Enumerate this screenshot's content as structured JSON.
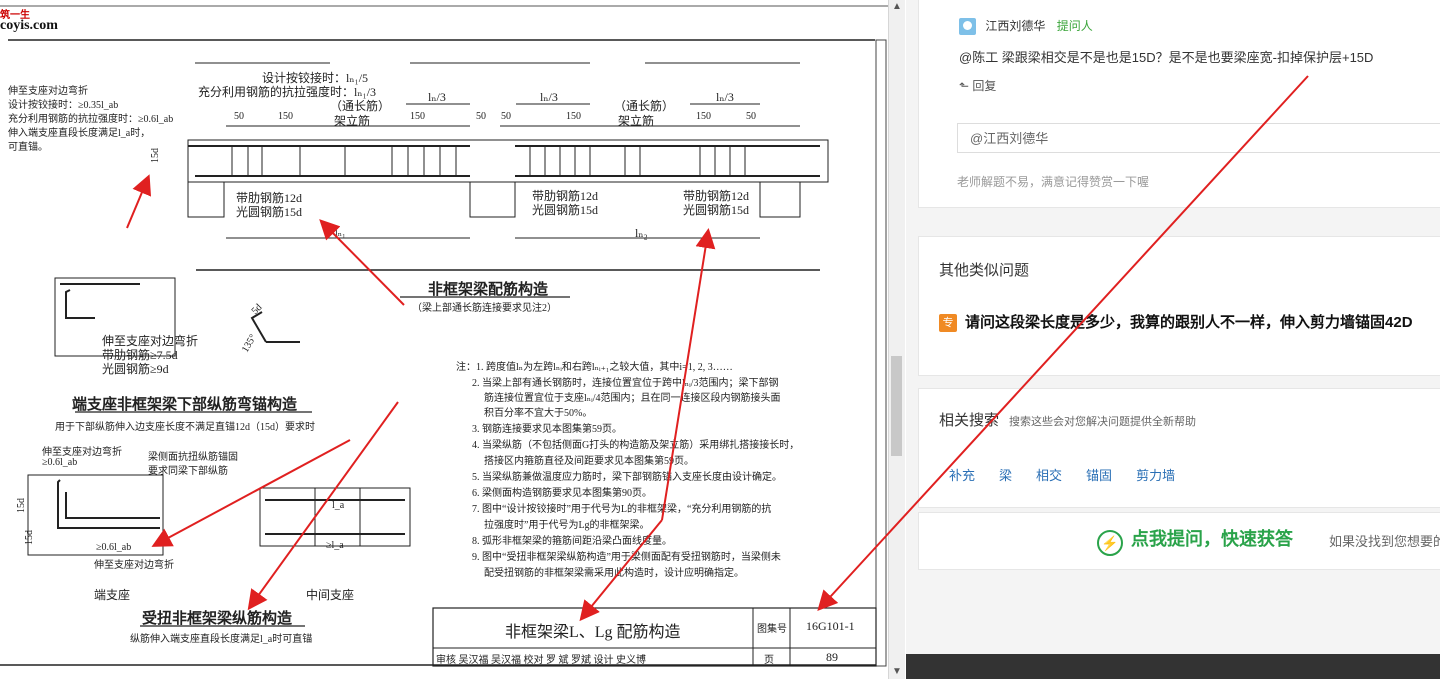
{
  "drawing": {
    "watermark_top": "筑一生",
    "watermark_site": "coyis.com",
    "main_title": "非框架梁配筋构造",
    "main_subtitle": "（梁上部通长筋连接要求见注2）",
    "design_hinge": "设计按铰接时：lₙ₁/5",
    "full_strength": "充分利用钢筋的抗拉强度时：lₙ₁/3",
    "through_bar_1": "（通长筋）",
    "erect_bar_1": "架立筋",
    "through_bar_2": "（通长筋）",
    "erect_bar_2": "架立筋",
    "ln3_1": "lₙ/3",
    "ln3_2": "lₙ/3",
    "ln3_3": "lₙ/3",
    "dim_50": "50",
    "dim_150": "150",
    "dim_15d": "15d",
    "ln1": "lₙ₁",
    "ln2": "lₙ₂",
    "ribbed_12d_1": "带肋钢筋12d",
    "round_15d_1": "光圆钢筋15d",
    "ribbed_12d_2": "带肋钢筋12d",
    "round_15d_2": "光圆钢筋15d",
    "ribbed_12d_3": "带肋钢筋12d",
    "round_15d_3": "光圆钢筋15d",
    "left_note_1": "伸至支座对边弯折",
    "left_note_2": "设计按铰接时：≥0.35l_ab",
    "left_note_3": "充分利用钢筋的抗拉强度时：≥0.6l_ab",
    "left_note_4": "伸入端支座直段长度满足l_a时，",
    "left_note_5": "可直锚。",
    "end_bend_1": "伸至支座对边弯折",
    "end_bend_2": "带肋钢筋≥7.5d",
    "end_bend_3": "光圆钢筋≥9d",
    "angle_135": "135°",
    "dim_5d": "5d",
    "end_anchor_title": "端支座非框架梁下部纵筋弯锚构造",
    "end_anchor_sub": "用于下部纵筋伸入边支座长度不满足直锚12d（15d）要求时",
    "torsion_1": "伸至支座对边弯折",
    "torsion_2": "≥0.6l_ab",
    "side_bar_1": "梁侧面抗扭纵筋锚固",
    "side_bar_2": "要求同梁下部纵筋",
    "torsion_3": "≥0.6l_ab",
    "torsion_4": "伸至支座对边弯折",
    "end_support": "端支座",
    "mid_support": "中间支座",
    "la_1": "l_a",
    "la_2": "≥l_a",
    "torsion_title": "受扭非框架梁纵筋构造",
    "torsion_sub": "纵筋伸入端支座直段长度满足l_a时可直锚",
    "notes": [
      "注：1. 跨度值lₙ为左跨lₙᵢ和右跨lₙᵢ₊₁之较大值，其中i=1, 2, 3……",
      "2. 当梁上部有通长钢筋时，连接位置宜位于跨中lₙᵢ/3范围内；梁下部钢",
      "筋连接位置宜位于支座lₙᵢ/4范围内；且在同一连接区段内钢筋接头面",
      "积百分率不宜大于50%。",
      "3. 钢筋连接要求见本图集第59页。",
      "4. 当梁纵筋（不包括侧面G打头的构造筋及架立筋）采用绑扎搭接接长时，",
      "搭接区内箍筋直径及间距要求见本图集第59页。",
      "5. 当梁纵筋兼做温度应力筋时，梁下部钢筋锚入支座长度由设计确定。",
      "6. 梁侧面构造钢筋要求见本图集第90页。",
      "7. 图中“设计按铰接时”用于代号为L的非框架梁，“充分利用钢筋的抗",
      "拉强度时”用于代号为Lg的非框架梁。",
      "8. 弧形非框架梁的箍筋间距沿梁凸面线度量。",
      "9. 图中“受扭非框架梁纵筋构造”用于梁侧面配有受扭钢筋时，当梁侧未",
      "配受扭钢筋的非框架梁需采用此构造时，设计应明确指定。"
    ],
    "titleblock_name": "非框架梁L、Lg 配筋构造",
    "titleblock_atlas_label": "图集号",
    "titleblock_atlas_no": "16G101-1",
    "titleblock_page_label": "页",
    "titleblock_page_no": "89",
    "titleblock_row": "审核 吴汉福 吴汉福 校对 罗 斌 罗斌 设计 史义博"
  },
  "scrollbar": {
    "up": "▲",
    "down": "▼"
  },
  "answer": {
    "username": "江西刘德华",
    "role": "提问人",
    "comment": "@陈工 梁跟梁相交是不是也是15D？是不是也要梁座宽-扣掉保护层+15D",
    "reply_label": "回复",
    "reply_icon": "reply-arrow-icon",
    "input_value": "@江西刘德华",
    "reward_tip": "老师解题不易，满意记得赞赏一下喔"
  },
  "similar": {
    "title": "其他类似问题",
    "tag": "专",
    "question": "请问这段梁长度是多少，我算的跟别人不一样，伸入剪力墙锚固42D"
  },
  "related": {
    "title": "相关搜索",
    "desc": "搜索这些会对您解决问题提供全新帮助",
    "links": [
      "补充",
      "梁",
      "相交",
      "锚固",
      "剪力墙"
    ]
  },
  "ask": {
    "icon": "lightning-icon",
    "label": "点我提问，快速获答",
    "hint": "如果没找到您想要的"
  },
  "colors": {
    "arrow": "#e02020",
    "green": "#2aa34a",
    "link": "#2a6fb5",
    "asker": "#3aa53a",
    "tag": "#f08a24"
  }
}
